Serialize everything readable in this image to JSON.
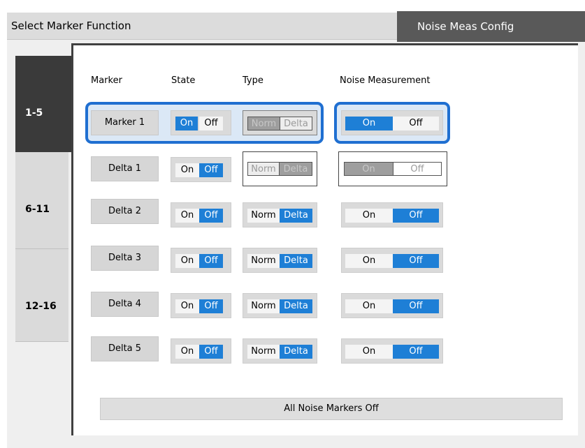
{
  "tabs": {
    "select_marker_function": "Select Marker Function",
    "noise_meas_config": "Noise Meas Config"
  },
  "side_tabs": [
    "1-5",
    "6-11",
    "12-16"
  ],
  "headers": {
    "marker": "Marker",
    "state": "State",
    "type": "Type",
    "noise_measurement": "Noise Measurement"
  },
  "rows": [
    {
      "marker": "Marker 1",
      "state_on": "On",
      "state_off": "Off",
      "type_norm": "Norm",
      "type_delta": "Delta",
      "noise_on": "On",
      "noise_off": "Off",
      "state": "On",
      "type": "Norm",
      "noise": "On"
    },
    {
      "marker": "Delta 1",
      "state_on": "On",
      "state_off": "Off",
      "type_norm": "Norm",
      "type_delta": "Delta",
      "noise_on": "On",
      "noise_off": "Off",
      "state": "Off",
      "type": "Delta",
      "noise": "On"
    },
    {
      "marker": "Delta 2",
      "state_on": "On",
      "state_off": "Off",
      "type_norm": "Norm",
      "type_delta": "Delta",
      "noise_on": "On",
      "noise_off": "Off",
      "state": "Off",
      "type": "Delta",
      "noise": "Off"
    },
    {
      "marker": "Delta 3",
      "state_on": "On",
      "state_off": "Off",
      "type_norm": "Norm",
      "type_delta": "Delta",
      "noise_on": "On",
      "noise_off": "Off",
      "state": "Off",
      "type": "Delta",
      "noise": "Off"
    },
    {
      "marker": "Delta 4",
      "state_on": "On",
      "state_off": "Off",
      "type_norm": "Norm",
      "type_delta": "Delta",
      "noise_on": "On",
      "noise_off": "Off",
      "state": "Off",
      "type": "Delta",
      "noise": "Off"
    },
    {
      "marker": "Delta 5",
      "state_on": "On",
      "state_off": "Off",
      "type_norm": "Norm",
      "type_delta": "Delta",
      "noise_on": "On",
      "noise_off": "Off",
      "state": "Off",
      "type": "Delta",
      "noise": "Off"
    }
  ],
  "all_noise_markers_off": "All Noise Markers Off",
  "colors": {
    "accent": "#1e7fd6",
    "focus_border": "#1f6fd1",
    "active_tab": "#3a3a3a",
    "header_tab": "#595959"
  }
}
